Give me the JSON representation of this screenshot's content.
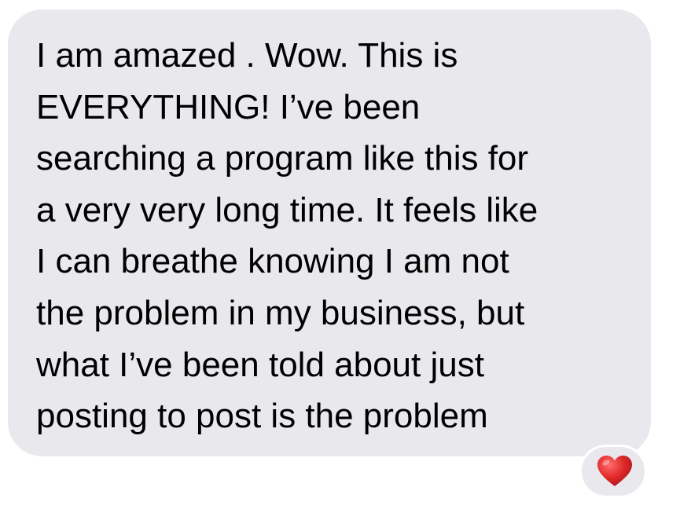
{
  "message": {
    "lines": [
      "I am amazed . Wow. This is",
      "EVERYTHING! I’ve been",
      "searching a program like this for",
      "a very very long time. It feels like",
      "I can breathe knowing I am not",
      "the problem in my business, but",
      "what I’ve been told about just",
      "posting to post is the problem"
    ]
  },
  "reaction": {
    "icon": "heart-icon",
    "color": "#d9202a"
  },
  "colors": {
    "bubble": "#e9e9ed",
    "text": "#000000",
    "background": "#ffffff"
  }
}
